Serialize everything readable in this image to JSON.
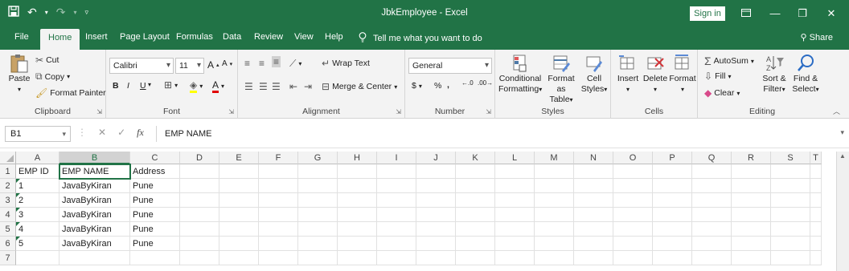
{
  "window": {
    "title": "JbkEmployee  -  Excel",
    "sign_in": "Sign in",
    "qat": {
      "save": "save-icon",
      "undo": "undo-icon",
      "redo": "redo-icon",
      "customize": "customize-icon"
    },
    "colors": {
      "brand": "#217346",
      "ribbon": "#f3f3f3"
    }
  },
  "tabs": [
    "File",
    "Home",
    "Insert",
    "Page Layout",
    "Formulas",
    "Data",
    "Review",
    "View",
    "Help"
  ],
  "tell_me": "Tell me what you want to do",
  "share": "Share",
  "ribbon": {
    "clipboard": {
      "paste": "Paste",
      "cut": "Cut",
      "copy": "Copy",
      "format_painter": "Format Painter",
      "label": "Clipboard"
    },
    "font": {
      "name": "Calibri",
      "size": "11",
      "bold": "B",
      "italic": "I",
      "underline": "U",
      "label": "Font"
    },
    "alignment": {
      "wrap_text": "Wrap Text",
      "merge_center": "Merge & Center",
      "label": "Alignment"
    },
    "number": {
      "format": "General",
      "currency": "$",
      "percent": "%",
      "comma": ",",
      "label": "Number"
    },
    "styles": {
      "conditional_1": "Conditional",
      "conditional_2": "Formatting",
      "format_as_1": "Format as",
      "format_as_2": "Table",
      "cell_1": "Cell",
      "cell_2": "Styles",
      "label": "Styles"
    },
    "cells": {
      "insert": "Insert",
      "delete": "Delete",
      "format": "Format",
      "label": "Cells"
    },
    "editing": {
      "autosum": "AutoSum",
      "fill": "Fill",
      "clear": "Clear",
      "sort_1": "Sort &",
      "sort_2": "Filter",
      "find_1": "Find &",
      "find_2": "Select",
      "label": "Editing"
    }
  },
  "formula_bar": {
    "name_box": "B1",
    "cancel": "✕",
    "enter": "✓",
    "fx": "fx",
    "formula": "EMP NAME"
  },
  "sheet": {
    "columns": [
      "A",
      "B",
      "C",
      "D",
      "E",
      "F",
      "G",
      "H",
      "I",
      "J",
      "K",
      "L",
      "M",
      "N",
      "O",
      "P",
      "Q",
      "R",
      "S",
      "T"
    ],
    "rows": [
      "1",
      "2",
      "3",
      "4",
      "5",
      "6",
      "7"
    ],
    "cells": [
      [
        "EMP ID",
        "EMP NAME",
        "Address"
      ],
      [
        "1",
        "JavaByKiran",
        "Pune"
      ],
      [
        "2",
        "JavaByKiran",
        "Pune"
      ],
      [
        "3",
        "JavaByKiran",
        "Pune"
      ],
      [
        "4",
        "JavaByKiran",
        "Pune"
      ],
      [
        "5",
        "JavaByKiran",
        "Pune"
      ],
      [
        "",
        "",
        ""
      ]
    ],
    "active_cell": "B1"
  }
}
